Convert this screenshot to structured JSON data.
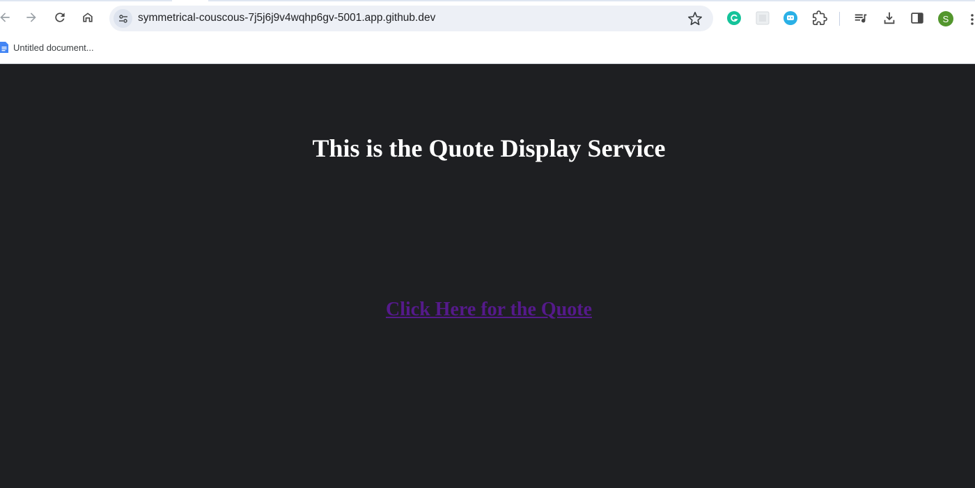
{
  "browser": {
    "url": "symmetrical-couscous-7j5j6j9v4wqhp6gv-5001.app.github.dev",
    "icons": {
      "back": "arrow-left-icon",
      "forward": "arrow-right-icon",
      "reload": "reload-icon",
      "home": "home-icon",
      "site_info": "tune-icon",
      "bookmark": "star-icon"
    },
    "extensions": [
      "grammarly-icon",
      "extension-thumbnail-icon",
      "chat-extension-icon",
      "puzzle-icon"
    ],
    "toolbar_right": [
      "reading-list-icon",
      "download-icon",
      "side-panel-icon"
    ],
    "profile_initial": "S",
    "colors": {
      "chrome_bg": "#ffffff",
      "omnibox_bg": "#edf0f6",
      "profile": "#53962d",
      "grammarly": "#15c39a",
      "chat_ext": "#2ab0e6"
    }
  },
  "bookmarks_bar": {
    "items": [
      {
        "label": "Untitled document...",
        "icon": "google-docs-icon"
      }
    ]
  },
  "page": {
    "heading": "This is the Quote Display Service",
    "link_label": "Click Here for the Quote",
    "colors": {
      "background": "#1e1f22",
      "heading": "#ffffff",
      "link": "#551a8b"
    }
  }
}
